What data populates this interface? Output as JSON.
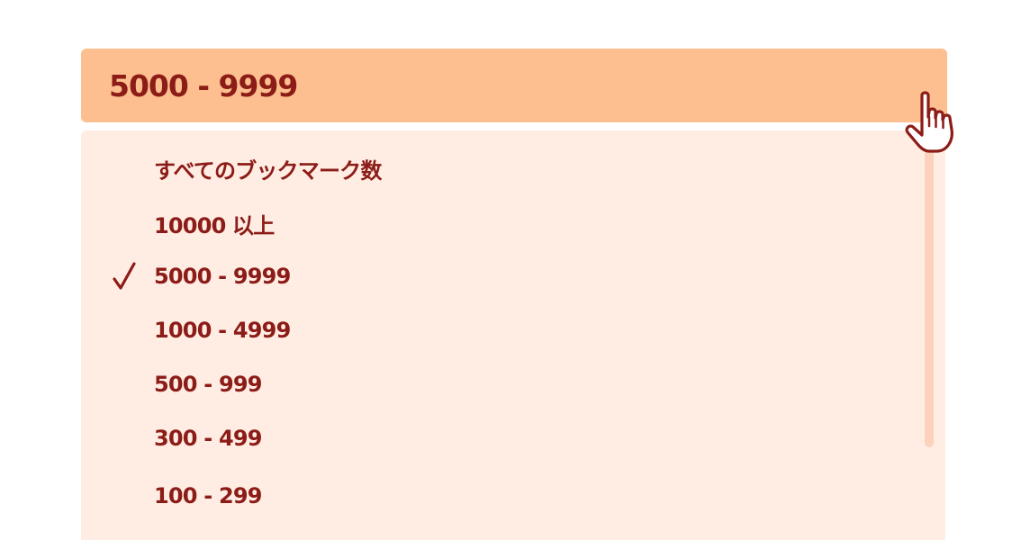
{
  "select": {
    "selected_value": "5000 - 9999"
  },
  "options": [
    {
      "label": "すべてのブックマーク数",
      "selected": false
    },
    {
      "label": "10000 以上",
      "selected": false
    },
    {
      "label": "5000 - 9999",
      "selected": true
    },
    {
      "label": "1000 - 4999",
      "selected": false
    },
    {
      "label": "500 - 999",
      "selected": false
    },
    {
      "label": "300 - 499",
      "selected": false
    },
    {
      "label": "100 - 299",
      "selected": false
    }
  ],
  "colors": {
    "header_bg": "#fdbf8f",
    "dropdown_bg": "#ffede4",
    "text": "#8c1c17",
    "scrollbar": "#fdd2bd"
  },
  "icons": {
    "check": "check-icon",
    "cursor": "pointer-hand-icon"
  }
}
